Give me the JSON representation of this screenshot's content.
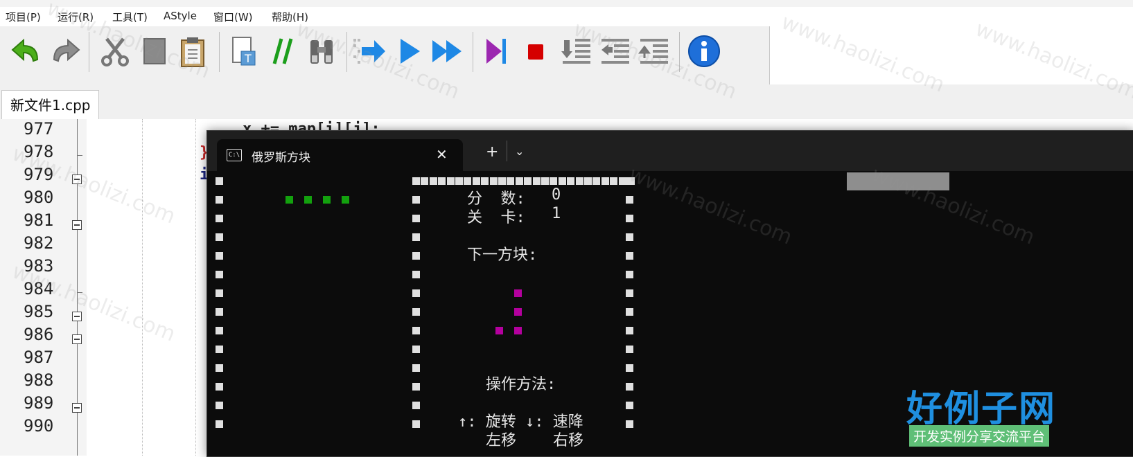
{
  "menu": [
    "项目(P)",
    "运行(R)",
    "工具(T)",
    "AStyle",
    "窗口(W)",
    "帮助(H)"
  ],
  "toolbar_icons": [
    "undo-icon",
    "redo-icon",
    "cut-icon",
    "copy-icon",
    "paste-icon",
    "insert-template-icon",
    "comment-icon",
    "binoculars-icon",
    "compile-icon",
    "run-icon",
    "compile-run-icon",
    "debug-icon",
    "stop-icon",
    "indent-icon",
    "unindent-icon",
    "toggle-icon",
    "about-icon"
  ],
  "editor": {
    "file_tab": "新文件1.cpp",
    "line_numbers": [
      "977",
      "978",
      "979",
      "980",
      "981",
      "982",
      "983",
      "984",
      "985",
      "986",
      "987",
      "988",
      "989",
      "990"
    ],
    "code_fragments": [
      "x += map[i][j];",
      "}",
      "i"
    ]
  },
  "terminal": {
    "tab_title": "俄罗斯方块",
    "tab_icon_text": "C:\\",
    "score_label": "分  数:",
    "score": "0",
    "level_label": "关  卡:",
    "level": "1",
    "next_label": "下一方块:",
    "controls_label": "操作方法:",
    "controls_line1": "↑: 旋转 ↓: 速降",
    "controls_line2": "左移    右移",
    "colors": {
      "border": "#e0e0e0",
      "falling_piece": "#13a10e",
      "next_piece": "#b4009e",
      "background": "#0c0c0c"
    }
  },
  "watermark": {
    "text": "www.haolizi.com",
    "logo": "好例子网",
    "slogan": "开发实例分享交流平台"
  }
}
